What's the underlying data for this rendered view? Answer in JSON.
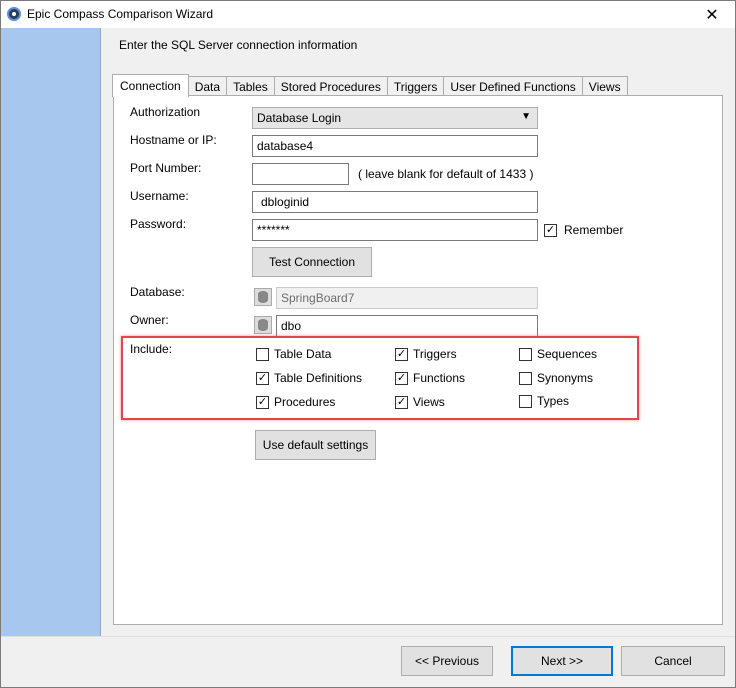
{
  "window": {
    "title": "Epic Compass Comparison Wizard",
    "close_glyph": "✕"
  },
  "instruction": "Enter the SQL Server connection information",
  "tabs": [
    "Connection",
    "Data",
    "Tables",
    "Stored Procedures",
    "Triggers",
    "User Defined Functions",
    "Views"
  ],
  "active_tab": "Connection",
  "form": {
    "authorization_label": "Authorization",
    "authorization_value": "Database Login",
    "hostname_label": "Hostname or IP:",
    "hostname_value": "database4",
    "port_label": "Port Number:",
    "port_value": "",
    "port_hint": "( leave blank for default of 1433 )",
    "username_label": "Username:",
    "username_value": "dbloginid",
    "password_label": "Password:",
    "password_value": "*******",
    "remember_label": "Remember",
    "remember_checked": true,
    "test_connection_label": "Test Connection",
    "database_label": "Database:",
    "database_value": "SpringBoard7",
    "owner_label": "Owner:",
    "owner_value": "dbo",
    "include_label": "Include:",
    "use_default_label": "Use default settings"
  },
  "include_options": [
    {
      "label": "Table Data",
      "checked": false
    },
    {
      "label": "Table Definitions",
      "checked": true
    },
    {
      "label": "Procedures",
      "checked": true
    },
    {
      "label": "Triggers",
      "checked": true
    },
    {
      "label": "Functions",
      "checked": true
    },
    {
      "label": "Views",
      "checked": true
    },
    {
      "label": "Sequences",
      "checked": false
    },
    {
      "label": "Synonyms",
      "checked": false
    },
    {
      "label": "Types",
      "checked": false
    }
  ],
  "footer": {
    "previous_label": "<< Previous",
    "next_label": "Next >>",
    "cancel_label": "Cancel"
  },
  "colors": {
    "sidebar": "#a8c7ee",
    "highlight": "#e0474c",
    "accent": "#0078d7"
  }
}
